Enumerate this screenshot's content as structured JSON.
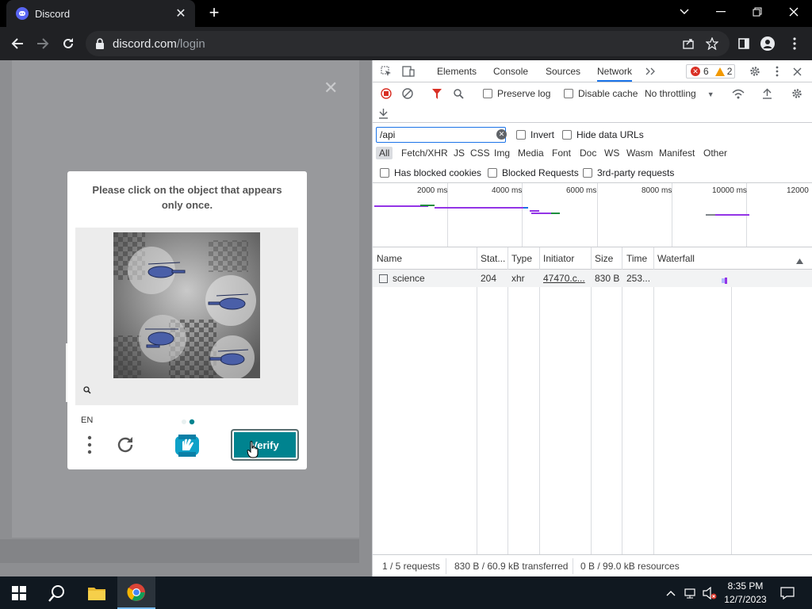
{
  "browser": {
    "tab_title": "Discord",
    "url_domain": "discord.com",
    "url_path": "/login"
  },
  "captcha": {
    "prompt": "Please click on the object that appears only once.",
    "language": "EN",
    "verify_label": "Verify"
  },
  "devtools": {
    "tabs": [
      "Elements",
      "Console",
      "Sources",
      "Network"
    ],
    "active_tab": "Network",
    "errors": "6",
    "warnings": "2",
    "preserve_log": "Preserve log",
    "disable_cache": "Disable cache",
    "throttling": "No throttling",
    "filter_value": "/api",
    "invert": "Invert",
    "hide_data_urls": "Hide data URLs",
    "types": [
      "All",
      "Fetch/XHR",
      "JS",
      "CSS",
      "Img",
      "Media",
      "Font",
      "Doc",
      "WS",
      "Wasm",
      "Manifest",
      "Other"
    ],
    "has_blocked_cookies": "Has blocked cookies",
    "blocked_requests": "Blocked Requests",
    "third_party": "3rd-party requests",
    "overview_ticks": [
      "2000 ms",
      "4000 ms",
      "6000 ms",
      "8000 ms",
      "10000 ms",
      "12000"
    ],
    "columns": [
      "Name",
      "Stat...",
      "Type",
      "Initiator",
      "Size",
      "Time",
      "Waterfall"
    ],
    "rows": [
      {
        "name": "science",
        "status": "204",
        "type": "xhr",
        "initiator": "47470.c...",
        "size": "830 B",
        "time": "253..."
      }
    ],
    "status": {
      "requests": "1 / 5 requests",
      "transferred": "830 B / 60.9 kB transferred",
      "resources": "0 B / 99.0 kB resources"
    }
  },
  "taskbar": {
    "time": "8:35 PM",
    "date": "12/7/2023"
  },
  "colors": {
    "accent": "#1a73e8",
    "verify": "#00838f",
    "discord": "#5865f2"
  }
}
